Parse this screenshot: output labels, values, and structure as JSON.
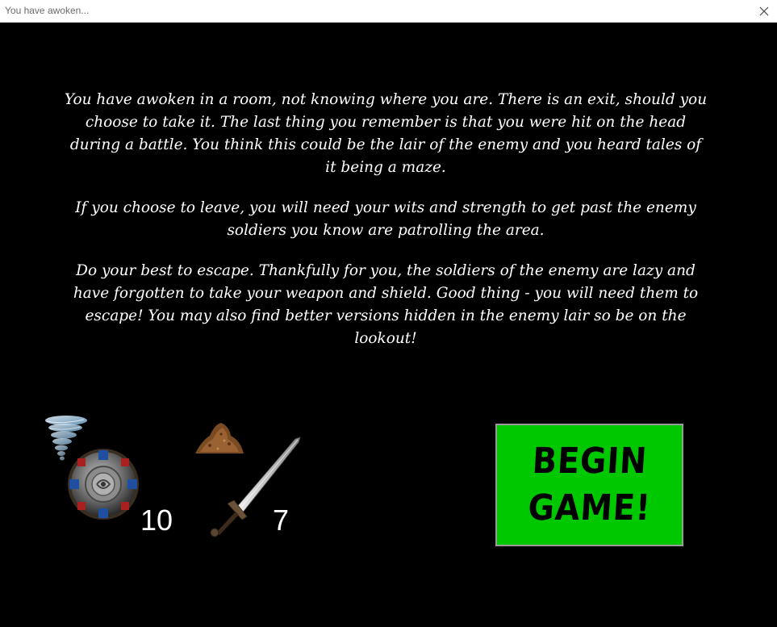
{
  "window": {
    "title": "You have awoken...",
    "close_glyph": "✕"
  },
  "story": {
    "paragraphs": [
      "You have awoken in a room, not knowing where you are. There is an exit, should you choose to take it. The last thing you remember is that you were hit on the head during a battle. You think this could be the lair of the enemy and you heard tales of it being a maze.",
      "If you choose to leave, you will need your wits and strength to get past the enemy soldiers you know are patrolling the area.",
      "Do your best to escape. Thankfully for you, the soldiers of the enemy are lazy and have forgotten to take your weapon and shield. Good thing - you will need them to escape! You may also find better versions hidden in the enemy lair so be on the lookout!"
    ]
  },
  "stats": {
    "defense_value": "10",
    "attack_value": "7"
  },
  "begin_button": {
    "line1": "BEGIN",
    "line2": "GAME!",
    "color": "#00c800"
  },
  "icons": {
    "defense_element": "tornado-icon",
    "shield": "shield-icon",
    "attack_element": "dirt-pile-icon",
    "weapon": "sword-icon"
  }
}
